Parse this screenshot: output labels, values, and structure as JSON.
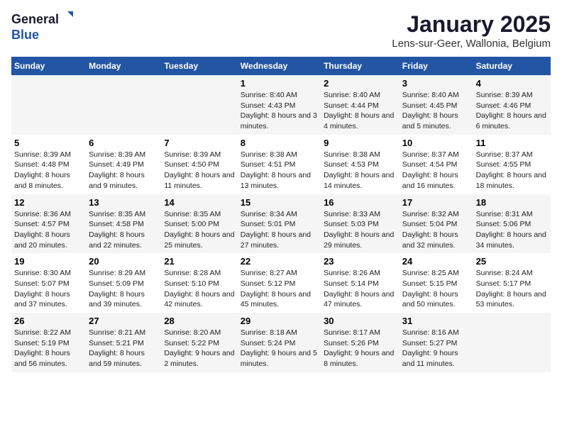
{
  "logo": {
    "general": "General",
    "blue": "Blue"
  },
  "title": "January 2025",
  "subtitle": "Lens-sur-Geer, Wallonia, Belgium",
  "headers": [
    "Sunday",
    "Monday",
    "Tuesday",
    "Wednesday",
    "Thursday",
    "Friday",
    "Saturday"
  ],
  "weeks": [
    [
      {
        "day": "",
        "text": ""
      },
      {
        "day": "",
        "text": ""
      },
      {
        "day": "",
        "text": ""
      },
      {
        "day": "1",
        "text": "Sunrise: 8:40 AM\nSunset: 4:43 PM\nDaylight: 8 hours and 3 minutes."
      },
      {
        "day": "2",
        "text": "Sunrise: 8:40 AM\nSunset: 4:44 PM\nDaylight: 8 hours and 4 minutes."
      },
      {
        "day": "3",
        "text": "Sunrise: 8:40 AM\nSunset: 4:45 PM\nDaylight: 8 hours and 5 minutes."
      },
      {
        "day": "4",
        "text": "Sunrise: 8:39 AM\nSunset: 4:46 PM\nDaylight: 8 hours and 6 minutes."
      }
    ],
    [
      {
        "day": "5",
        "text": "Sunrise: 8:39 AM\nSunset: 4:48 PM\nDaylight: 8 hours and 8 minutes."
      },
      {
        "day": "6",
        "text": "Sunrise: 8:39 AM\nSunset: 4:49 PM\nDaylight: 8 hours and 9 minutes."
      },
      {
        "day": "7",
        "text": "Sunrise: 8:39 AM\nSunset: 4:50 PM\nDaylight: 8 hours and 11 minutes."
      },
      {
        "day": "8",
        "text": "Sunrise: 8:38 AM\nSunset: 4:51 PM\nDaylight: 8 hours and 13 minutes."
      },
      {
        "day": "9",
        "text": "Sunrise: 8:38 AM\nSunset: 4:53 PM\nDaylight: 8 hours and 14 minutes."
      },
      {
        "day": "10",
        "text": "Sunrise: 8:37 AM\nSunset: 4:54 PM\nDaylight: 8 hours and 16 minutes."
      },
      {
        "day": "11",
        "text": "Sunrise: 8:37 AM\nSunset: 4:55 PM\nDaylight: 8 hours and 18 minutes."
      }
    ],
    [
      {
        "day": "12",
        "text": "Sunrise: 8:36 AM\nSunset: 4:57 PM\nDaylight: 8 hours and 20 minutes."
      },
      {
        "day": "13",
        "text": "Sunrise: 8:35 AM\nSunset: 4:58 PM\nDaylight: 8 hours and 22 minutes."
      },
      {
        "day": "14",
        "text": "Sunrise: 8:35 AM\nSunset: 5:00 PM\nDaylight: 8 hours and 25 minutes."
      },
      {
        "day": "15",
        "text": "Sunrise: 8:34 AM\nSunset: 5:01 PM\nDaylight: 8 hours and 27 minutes."
      },
      {
        "day": "16",
        "text": "Sunrise: 8:33 AM\nSunset: 5:03 PM\nDaylight: 8 hours and 29 minutes."
      },
      {
        "day": "17",
        "text": "Sunrise: 8:32 AM\nSunset: 5:04 PM\nDaylight: 8 hours and 32 minutes."
      },
      {
        "day": "18",
        "text": "Sunrise: 8:31 AM\nSunset: 5:06 PM\nDaylight: 8 hours and 34 minutes."
      }
    ],
    [
      {
        "day": "19",
        "text": "Sunrise: 8:30 AM\nSunset: 5:07 PM\nDaylight: 8 hours and 37 minutes."
      },
      {
        "day": "20",
        "text": "Sunrise: 8:29 AM\nSunset: 5:09 PM\nDaylight: 8 hours and 39 minutes."
      },
      {
        "day": "21",
        "text": "Sunrise: 8:28 AM\nSunset: 5:10 PM\nDaylight: 8 hours and 42 minutes."
      },
      {
        "day": "22",
        "text": "Sunrise: 8:27 AM\nSunset: 5:12 PM\nDaylight: 8 hours and 45 minutes."
      },
      {
        "day": "23",
        "text": "Sunrise: 8:26 AM\nSunset: 5:14 PM\nDaylight: 8 hours and 47 minutes."
      },
      {
        "day": "24",
        "text": "Sunrise: 8:25 AM\nSunset: 5:15 PM\nDaylight: 8 hours and 50 minutes."
      },
      {
        "day": "25",
        "text": "Sunrise: 8:24 AM\nSunset: 5:17 PM\nDaylight: 8 hours and 53 minutes."
      }
    ],
    [
      {
        "day": "26",
        "text": "Sunrise: 8:22 AM\nSunset: 5:19 PM\nDaylight: 8 hours and 56 minutes."
      },
      {
        "day": "27",
        "text": "Sunrise: 8:21 AM\nSunset: 5:21 PM\nDaylight: 8 hours and 59 minutes."
      },
      {
        "day": "28",
        "text": "Sunrise: 8:20 AM\nSunset: 5:22 PM\nDaylight: 9 hours and 2 minutes."
      },
      {
        "day": "29",
        "text": "Sunrise: 8:18 AM\nSunset: 5:24 PM\nDaylight: 9 hours and 5 minutes."
      },
      {
        "day": "30",
        "text": "Sunrise: 8:17 AM\nSunset: 5:26 PM\nDaylight: 9 hours and 8 minutes."
      },
      {
        "day": "31",
        "text": "Sunrise: 8:16 AM\nSunset: 5:27 PM\nDaylight: 9 hours and 11 minutes."
      },
      {
        "day": "",
        "text": ""
      }
    ]
  ]
}
